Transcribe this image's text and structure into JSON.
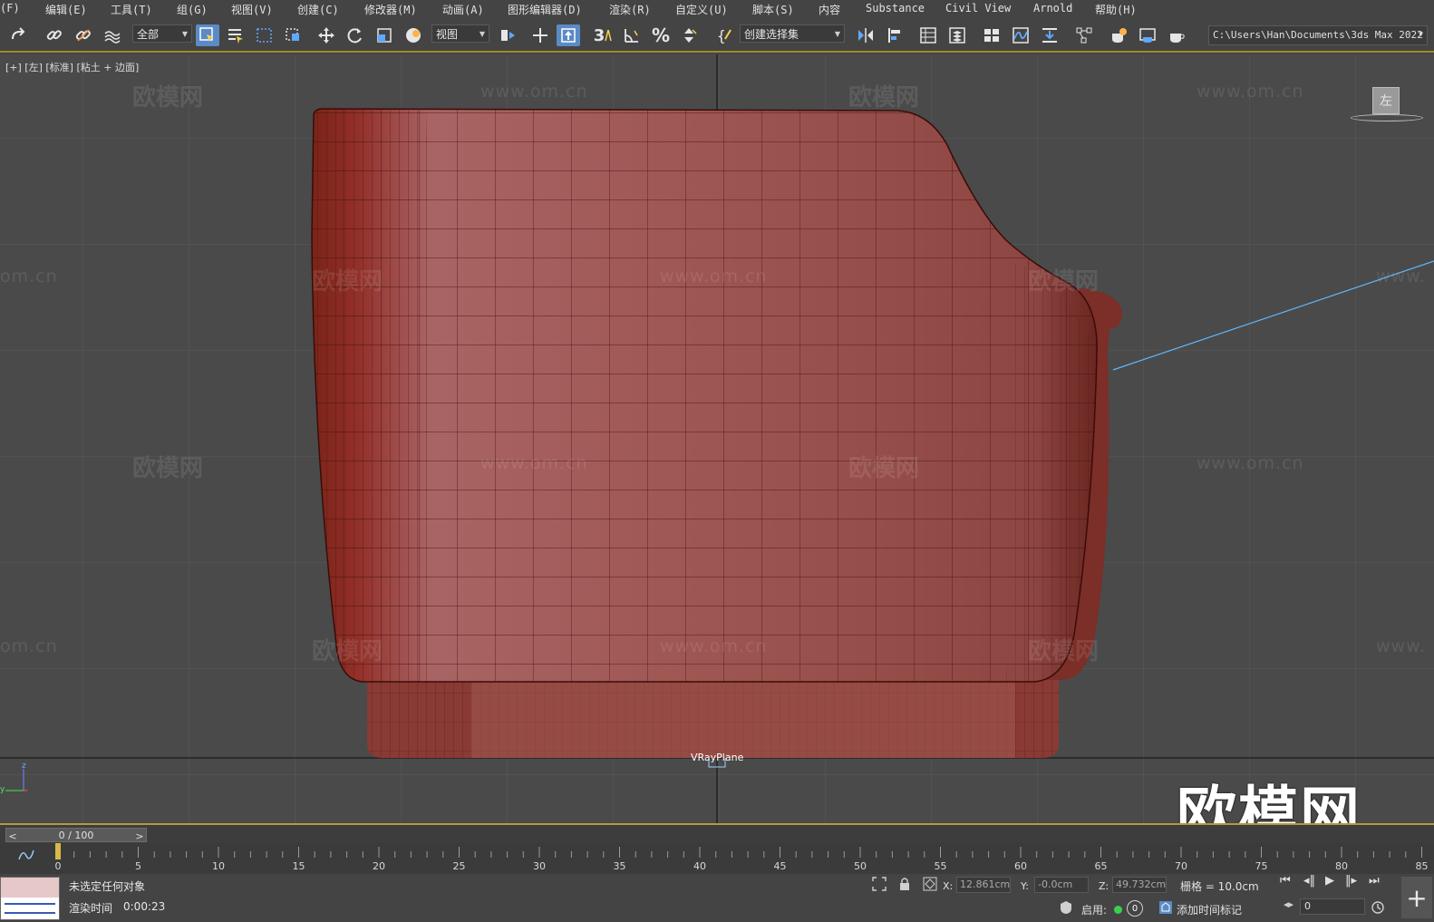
{
  "menubar": {
    "items": [
      "(F)",
      "编辑(E)",
      "工具(T)",
      "组(G)",
      "视图(V)",
      "创建(C)",
      "修改器(M)",
      "动画(A)",
      "图形编辑器(D)",
      "渲染(R)",
      "自定义(U)",
      "脚本(S)",
      "内容",
      "Substance",
      "Civil View",
      "Arnold",
      "帮助(H)"
    ]
  },
  "toolbar": {
    "selection_filter": "全部",
    "reference_coord": "视图",
    "snap_count": "3",
    "named_selection": "创建选择集",
    "project_path": "C:\\Users\\Han\\Documents\\3ds Max 2022"
  },
  "viewport": {
    "label": "[+] [左] [标准] [粘土 + 边面]",
    "object_label": "VRayPlane",
    "viewcube_face": "左",
    "watermark_cn": "欧模网",
    "watermark_url": "www.om.cn",
    "watermark_url_partial_left": "om.cn",
    "watermark_url_partial_right": "www.",
    "logo_text": "欧模网",
    "model_color": "#9a4a44",
    "axis": {
      "z": "z",
      "y": "y"
    }
  },
  "timeslider": {
    "frame_display": "0 / 100",
    "prev_label": "<",
    "next_label": ">"
  },
  "trackbar": {
    "ticks": [
      "0",
      "5",
      "10",
      "15",
      "20",
      "25",
      "30",
      "35",
      "40",
      "45",
      "50",
      "55",
      "60",
      "65",
      "70",
      "75",
      "80",
      "85"
    ]
  },
  "statusbar": {
    "selection_status": "未选定任何对象",
    "render_time_label": "渲染时间",
    "render_time_value": "0:00:23",
    "x_label": "X:",
    "x_value": "12.861cm",
    "y_label": "Y:",
    "y_value": "-0.0cm",
    "z_label": "Z:",
    "z_value": "49.732cm",
    "grid_text": "栅格 = 10.0cm",
    "enable_label": "启用:",
    "enable_count": "0",
    "add_key_label": "添加时间标记",
    "key_frame_value": "0"
  }
}
